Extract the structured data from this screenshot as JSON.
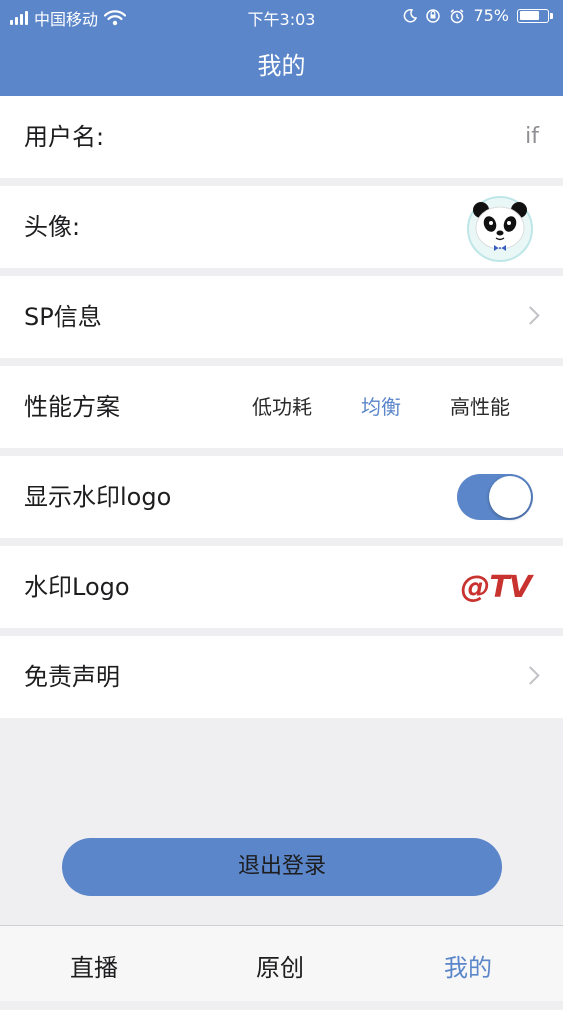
{
  "status_bar": {
    "carrier": "中国移动",
    "time": "下午3:03",
    "battery": "75%",
    "battery_level": 0.75,
    "icons": [
      "signal-icon",
      "wifi-icon",
      "moon-icon",
      "orientation-lock-icon",
      "alarm-icon",
      "battery-icon"
    ]
  },
  "header": {
    "title": "我的"
  },
  "rows": {
    "username": {
      "label": "用户名:",
      "value": "if"
    },
    "avatar": {
      "label": "头像:",
      "icon": "panda-avatar"
    },
    "sp_info": {
      "label": "SP信息"
    },
    "performance": {
      "label": "性能方案",
      "options": [
        "低功耗",
        "均衡",
        "高性能"
      ],
      "selected": "均衡"
    },
    "show_watermark": {
      "label": "显示水印logo",
      "enabled": true
    },
    "watermark_logo": {
      "label": "水印Logo",
      "logo_text": "@TV"
    },
    "disclaimer": {
      "label": "免责声明"
    }
  },
  "logout_button": "退出登录",
  "tabbar": {
    "tabs": [
      "直播",
      "原创",
      "我的"
    ],
    "active": "我的"
  },
  "colors": {
    "accent": "#5b86c9",
    "background": "#efeff1",
    "logo_red": "#c8332f"
  }
}
